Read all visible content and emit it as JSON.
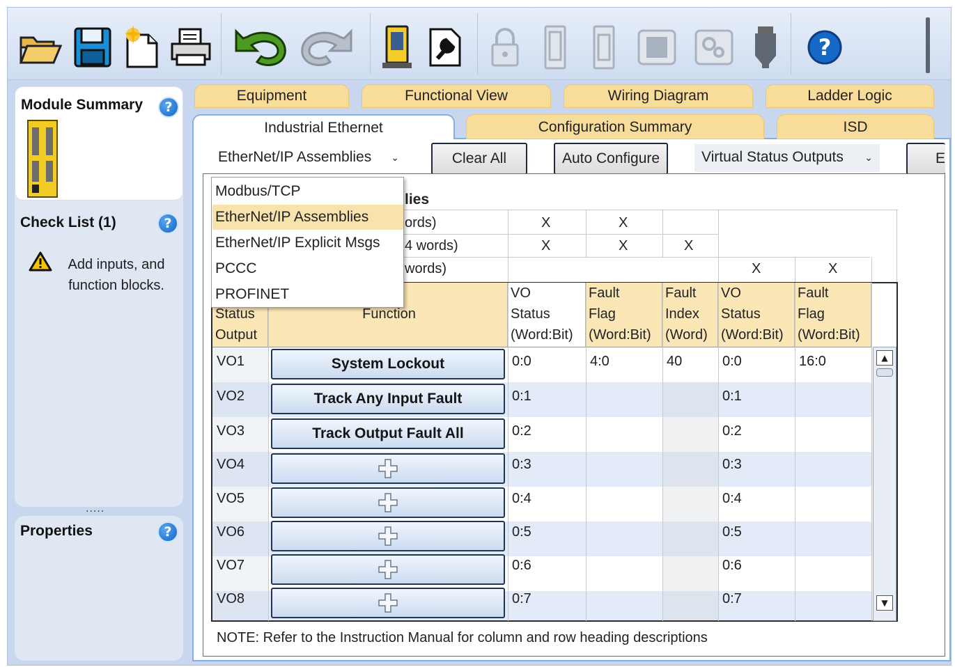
{
  "toolbar": {
    "icons": [
      "open-folder-icon",
      "save-icon",
      "new-file-icon",
      "print-icon",
      "undo-icon",
      "redo-icon",
      "controller-icon",
      "configure-icon",
      "lock-icon",
      "module-icon",
      "module-icon-2",
      "chip-icon",
      "gears-icon",
      "plug-icon",
      "help-icon"
    ]
  },
  "left": {
    "module_summary": {
      "title": "Module Summary",
      "help": "?"
    },
    "check_list": {
      "title": "Check List (1)",
      "help": "?",
      "warning": "Add inputs, and function blocks.",
      "warning_line1": "Add inputs, and",
      "warning_line2": "function blocks."
    },
    "properties": {
      "title": "Properties",
      "help": "?"
    },
    "splitter": "....."
  },
  "tabs_top": [
    "Equipment",
    "Functional View",
    "Wiring Diagram",
    "Ladder Logic"
  ],
  "tabs_second": [
    "Industrial Ethernet",
    "Configuration Summary",
    "ISD"
  ],
  "controls": {
    "protocol_select": "EtherNet/IP Assemblies",
    "clear_all": "Clear All",
    "auto_configure": "Auto Configure",
    "view_select": "Virtual Status Outputs",
    "extra_button": "E"
  },
  "dropdown": {
    "options": [
      "Modbus/TCP",
      "EtherNet/IP Assemblies",
      "EtherNet/IP Explicit Msgs",
      "PCCC",
      "PROFINET"
    ],
    "selected": "EtherNet/IP Assemblies"
  },
  "assemblies": {
    "title_fragment": "lies",
    "rows": [
      {
        "label": "ords)",
        "marks": [
          "X",
          "X",
          "",
          "",
          ""
        ]
      },
      {
        "label": "4 words)",
        "marks": [
          "X",
          "X",
          "X",
          "",
          ""
        ]
      },
      {
        "label": "words)",
        "marks": [
          "",
          "",
          "",
          "X",
          "X"
        ]
      }
    ]
  },
  "table": {
    "headers": {
      "status_output": [
        "Status",
        "Output"
      ],
      "function": "Function",
      "vo_status_1": [
        "VO",
        "Status",
        "(Word:Bit)"
      ],
      "fault_flag_1": [
        "Fault",
        "Flag",
        "(Word:Bit)"
      ],
      "fault_index": [
        "Fault",
        "Index",
        "(Word)"
      ],
      "vo_status_2": [
        "VO",
        "Status",
        "(Word:Bit)"
      ],
      "fault_flag_2": [
        "Fault",
        "Flag",
        "(Word:Bit)"
      ]
    },
    "rows": [
      {
        "vo": "VO1",
        "function": "System Lockout",
        "vo_status": "0:0",
        "fault_flag": "4:0",
        "fault_index": "40",
        "vo_status2": "0:0",
        "fault_flag2": "16:0"
      },
      {
        "vo": "VO2",
        "function": "Track Any Input Fault",
        "vo_status": "0:1",
        "fault_flag": "",
        "fault_index": "",
        "vo_status2": "0:1",
        "fault_flag2": ""
      },
      {
        "vo": "VO3",
        "function": "Track Output Fault All",
        "vo_status": "0:2",
        "fault_flag": "",
        "fault_index": "",
        "vo_status2": "0:2",
        "fault_flag2": ""
      },
      {
        "vo": "VO4",
        "function": "",
        "vo_status": "0:3",
        "fault_flag": "",
        "fault_index": "",
        "vo_status2": "0:3",
        "fault_flag2": ""
      },
      {
        "vo": "VO5",
        "function": "",
        "vo_status": "0:4",
        "fault_flag": "",
        "fault_index": "",
        "vo_status2": "0:4",
        "fault_flag2": ""
      },
      {
        "vo": "VO6",
        "function": "",
        "vo_status": "0:5",
        "fault_flag": "",
        "fault_index": "",
        "vo_status2": "0:5",
        "fault_flag2": ""
      },
      {
        "vo": "VO7",
        "function": "",
        "vo_status": "0:6",
        "fault_flag": "",
        "fault_index": "",
        "vo_status2": "0:6",
        "fault_flag2": ""
      },
      {
        "vo": "VO8",
        "function": "",
        "vo_status": "0:7",
        "fault_flag": "",
        "fault_index": "",
        "vo_status2": "0:7",
        "fault_flag2": ""
      }
    ]
  },
  "note": "NOTE: Refer to the Instruction Manual for column and row heading descriptions",
  "colors": {
    "tab": "#f8dd9a",
    "header": "#fbe6b5",
    "selection": "#f9e3ad",
    "accent": "#7fb0e8",
    "panel": "#dfe7f3",
    "help": "#1366c5"
  }
}
